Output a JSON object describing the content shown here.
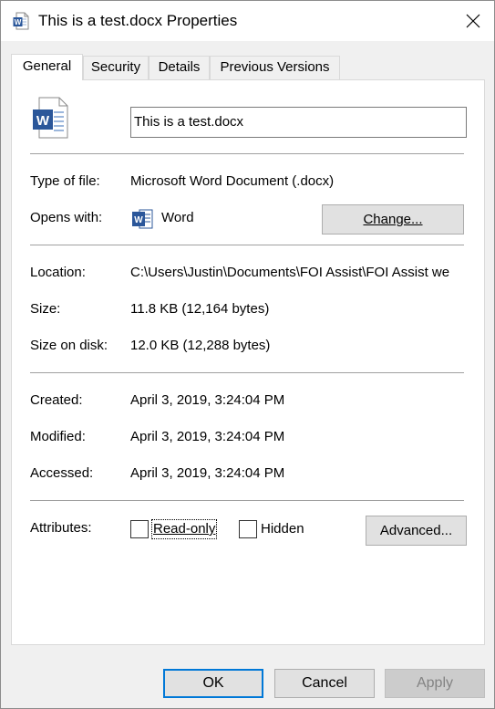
{
  "window": {
    "title": "This is a test.docx Properties"
  },
  "tabs": [
    {
      "label": "General",
      "active": true
    },
    {
      "label": "Security",
      "active": false
    },
    {
      "label": "Details",
      "active": false
    },
    {
      "label": "Previous Versions",
      "active": false
    }
  ],
  "file": {
    "name": "This is a test.docx",
    "icon": "word-document-icon"
  },
  "type_row": {
    "label": "Type of file:",
    "value": "Microsoft Word Document (.docx)"
  },
  "opens_row": {
    "label": "Opens with:",
    "value": "Word",
    "button": "Change...",
    "icon": "word-app-icon"
  },
  "location_row": {
    "label": "Location:",
    "value": "C:\\Users\\Justin\\Documents\\FOI Assist\\FOI Assist we"
  },
  "size_row": {
    "label": "Size:",
    "value": "11.8 KB (12,164 bytes)"
  },
  "size_disk_row": {
    "label": "Size on disk:",
    "value": "12.0 KB (12,288 bytes)"
  },
  "created_row": {
    "label": "Created:",
    "value": "April 3, 2019, 3:24:04 PM"
  },
  "modified_row": {
    "label": "Modified:",
    "value": "April 3, 2019, 3:24:04 PM"
  },
  "accessed_row": {
    "label": "Accessed:",
    "value": "April 3, 2019, 3:24:04 PM"
  },
  "attributes": {
    "label": "Attributes:",
    "readonly": {
      "label": "Read-only",
      "checked": false
    },
    "hidden": {
      "label": "Hidden",
      "checked": false
    },
    "advanced_button": "Advanced..."
  },
  "footer": {
    "ok": "OK",
    "cancel": "Cancel",
    "apply": "Apply"
  },
  "colors": {
    "word_blue": "#2b579a",
    "focus_blue": "#0078d7"
  }
}
